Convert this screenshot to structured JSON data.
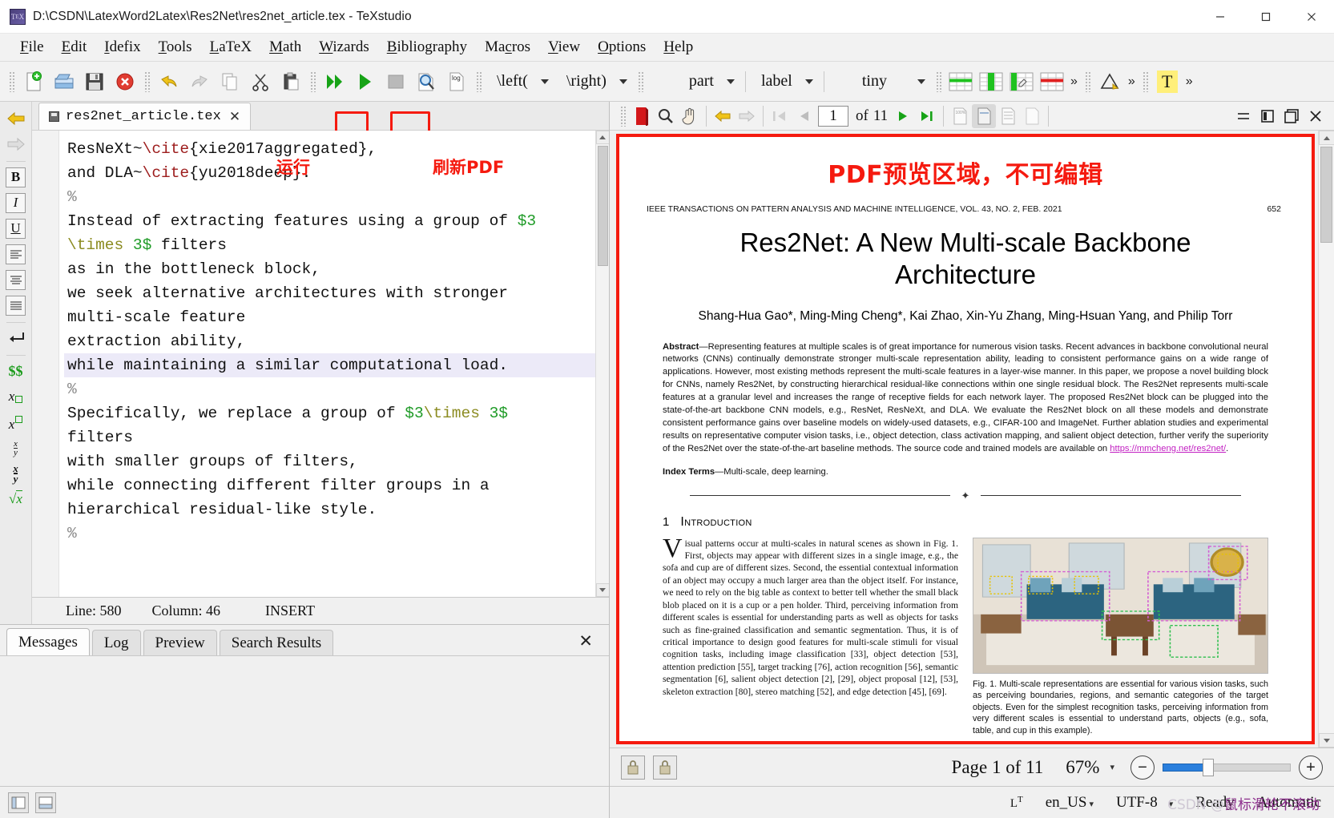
{
  "window": {
    "title": "D:\\CSDN\\LatexWord2Latex\\Res2Net\\res2net_article.tex - TeXstudio",
    "minimize": "–",
    "maximize": "☐",
    "close": "✕"
  },
  "menu": [
    {
      "label": "File",
      "accel": "F"
    },
    {
      "label": "Edit",
      "accel": "E"
    },
    {
      "label": "Idefix",
      "accel": "I"
    },
    {
      "label": "Tools",
      "accel": "T"
    },
    {
      "label": "LaTeX",
      "accel": "L"
    },
    {
      "label": "Math",
      "accel": "M"
    },
    {
      "label": "Wizards",
      "accel": "W"
    },
    {
      "label": "Bibliography",
      "accel": "B"
    },
    {
      "label": "Macros",
      "accel": "c"
    },
    {
      "label": "View",
      "accel": "V"
    },
    {
      "label": "Options",
      "accel": "O"
    },
    {
      "label": "Help",
      "accel": "H"
    }
  ],
  "toolbar": {
    "icons": [
      "new-file-icon",
      "open-file-icon",
      "save-file-icon",
      "close-file-icon",
      "undo-icon",
      "redo-icon",
      "copy-icon",
      "cut-icon",
      "paste-icon",
      "build-and-view-icon",
      "compile-run-icon",
      "stop-icon",
      "view-pdf-icon",
      "log-icon"
    ],
    "combos": [
      {
        "label": "\\left(",
        "name": "left-delimiter-combo"
      },
      {
        "label": "\\right)",
        "name": "right-delimiter-combo"
      },
      {
        "label": "part",
        "name": "section-level-combo"
      },
      {
        "label": "label",
        "name": "label-combo"
      },
      {
        "label": "tiny",
        "name": "font-size-combo"
      }
    ],
    "table_icons": [
      "table-insert-row-icon",
      "table-insert-column-icon",
      "table-edit-icon",
      "table-delete-row-icon"
    ],
    "overflow": "»",
    "extra_icons": [
      "triangle-tool-icon",
      "text-tool-icon"
    ]
  },
  "annotations": [
    {
      "text": "运行",
      "name": "run-annotation"
    },
    {
      "text": "刷新PDF",
      "name": "refresh-pdf-annotation"
    },
    {
      "text": "PDF预览区域，不可编辑",
      "name": "pdf-preview-annotation"
    }
  ],
  "sidebar": {
    "items": [
      {
        "label": "⬅",
        "name": "sidebar-back-icon"
      },
      {
        "label": "➡",
        "name": "sidebar-forward-icon"
      },
      {
        "label": "B",
        "name": "sidebar-bold-icon"
      },
      {
        "label": "I",
        "name": "sidebar-italic-icon"
      },
      {
        "label": "U",
        "name": "sidebar-underline-icon"
      },
      {
        "label": "≡",
        "name": "sidebar-align-left-icon"
      },
      {
        "label": "≡",
        "name": "sidebar-align-center-icon"
      },
      {
        "label": "≡",
        "name": "sidebar-align-right-icon"
      },
      {
        "label": "↵",
        "name": "sidebar-newline-icon"
      },
      {
        "label": "$$",
        "name": "sidebar-display-math-icon"
      },
      {
        "label": "x□",
        "name": "sidebar-subscript-icon"
      },
      {
        "label": "x□",
        "name": "sidebar-superscript-icon"
      },
      {
        "label": "x/y",
        "name": "sidebar-fraction-icon"
      },
      {
        "label": "x/y",
        "name": "sidebar-dfrac-icon"
      },
      {
        "label": "√x",
        "name": "sidebar-sqrt-icon"
      }
    ]
  },
  "editor": {
    "tab": {
      "filename": "res2net_article.tex",
      "close": "✕"
    },
    "lines": [
      {
        "id": 1,
        "highlight": false,
        "segments": [
          {
            "t": "ResNeXt~",
            "c": "plain"
          },
          {
            "t": "\\cite",
            "c": "cmd"
          },
          {
            "t": "{xie2017aggregated},",
            "c": "plain"
          }
        ]
      },
      {
        "id": 2,
        "highlight": false,
        "segments": [
          {
            "t": "and DLA~",
            "c": "plain"
          },
          {
            "t": "\\cite",
            "c": "cmd"
          },
          {
            "t": "{yu2018deep}.",
            "c": "plain"
          }
        ]
      },
      {
        "id": 3,
        "highlight": false,
        "segments": [
          {
            "t": "%",
            "c": "pct"
          }
        ]
      },
      {
        "id": 4,
        "highlight": false,
        "segments": [
          {
            "t": "Instead of extracting features using a group of ",
            "c": "plain"
          },
          {
            "t": "$3",
            "c": "math"
          }
        ]
      },
      {
        "id": 5,
        "highlight": false,
        "segments": [
          {
            "t": "\\times",
            "c": "texcmd"
          },
          {
            "t": " ",
            "c": "plain"
          },
          {
            "t": "3$",
            "c": "math"
          },
          {
            "t": " filters",
            "c": "plain"
          }
        ]
      },
      {
        "id": 6,
        "highlight": false,
        "segments": [
          {
            "t": "as in the bottleneck block,",
            "c": "plain"
          }
        ]
      },
      {
        "id": 7,
        "highlight": false,
        "segments": [
          {
            "t": "we seek alternative architectures with stronger",
            "c": "plain"
          }
        ]
      },
      {
        "id": 8,
        "highlight": false,
        "segments": [
          {
            "t": "multi-scale feature",
            "c": "plain"
          }
        ]
      },
      {
        "id": 9,
        "highlight": false,
        "segments": [
          {
            "t": "extraction ability,",
            "c": "plain"
          }
        ]
      },
      {
        "id": 10,
        "highlight": true,
        "segments": [
          {
            "t": "while maintaining a similar computational load.",
            "c": "plain"
          }
        ]
      },
      {
        "id": 11,
        "highlight": false,
        "segments": [
          {
            "t": "%",
            "c": "pct"
          }
        ]
      },
      {
        "id": 12,
        "highlight": false,
        "segments": [
          {
            "t": "Specifically, we replace a group of ",
            "c": "plain"
          },
          {
            "t": "$3",
            "c": "math"
          },
          {
            "t": "\\times",
            "c": "texcmd"
          },
          {
            "t": " ",
            "c": "plain"
          },
          {
            "t": "3$",
            "c": "math"
          }
        ]
      },
      {
        "id": 13,
        "highlight": false,
        "segments": [
          {
            "t": "filters",
            "c": "plain"
          }
        ]
      },
      {
        "id": 14,
        "highlight": false,
        "segments": [
          {
            "t": "with smaller groups of filters,",
            "c": "plain"
          }
        ]
      },
      {
        "id": 15,
        "highlight": false,
        "segments": [
          {
            "t": "while connecting different filter groups in a",
            "c": "plain"
          }
        ]
      },
      {
        "id": 16,
        "highlight": false,
        "segments": [
          {
            "t": "hierarchical residual-like style.",
            "c": "plain"
          }
        ]
      },
      {
        "id": 17,
        "highlight": false,
        "segments": [
          {
            "t": "%",
            "c": "pct"
          }
        ]
      }
    ],
    "status": {
      "line": "Line: 580",
      "column": "Column: 46",
      "mode": "INSERT"
    }
  },
  "messages_panel": {
    "tabs": [
      {
        "label": "Messages",
        "active": true
      },
      {
        "label": "Log",
        "active": false
      },
      {
        "label": "Preview",
        "active": false
      },
      {
        "label": "Search Results",
        "active": false
      }
    ],
    "close": "✕"
  },
  "pdf_toolbar": {
    "icons": [
      "pdf-file-icon",
      "magnify-icon",
      "hand-tool-icon",
      "back-arrow-icon",
      "forward-arrow-icon",
      "first-page-icon",
      "prev-page-icon"
    ],
    "page_value": "1",
    "of_label": "of",
    "page_count": "11",
    "next_icons": [
      "next-page-icon",
      "last-page-icon"
    ],
    "view_mode_icons": [
      "fit-width-icon",
      "fit-page-icon",
      "continuous-icon",
      "single-page-icon"
    ],
    "window_icons": [
      "minimize-pdf-icon",
      "embed-pdf-icon",
      "detach-pdf-icon",
      "close-pdf-icon"
    ]
  },
  "pdf": {
    "journal_header": "IEEE TRANSACTIONS ON PATTERN ANALYSIS AND MACHINE INTELLIGENCE, VOL. 43, NO. 2, FEB. 2021",
    "page_number": "652",
    "title": "Res2Net: A New Multi-scale Backbone Architecture",
    "authors": "Shang-Hua Gao*,  Ming-Ming Cheng*,  Kai Zhao,  Xin-Yu Zhang,  Ming-Hsuan Yang,  and Philip Torr",
    "abstract_label": "Abstract",
    "abstract_body": "—Representing features at multiple scales is of great importance for numerous vision tasks. Recent advances in backbone convolutional neural networks (CNNs) continually demonstrate stronger multi-scale representation ability, leading to consistent performance gains on a wide range of applications. However, most existing methods represent the multi-scale features in a layer-wise manner. In this paper, we propose a novel building block for CNNs, namely Res2Net, by constructing hierarchical residual-like connections within one single residual block. The Res2Net represents multi-scale features at a granular level and increases the range of receptive fields for each network layer. The proposed Res2Net block can be plugged into the state-of-the-art backbone CNN models, e.g., ResNet, ResNeXt, and DLA. We evaluate the Res2Net block on all these models and demonstrate consistent performance gains over baseline models on widely-used datasets, e.g., CIFAR-100 and ImageNet. Further ablation studies and experimental results on representative computer vision tasks, i.e., object detection, class activation mapping, and salient object detection, further verify the superiority of the Res2Net over the state-of-the-art baseline methods. The source code and trained models are available on ",
    "abstract_link": "https://mmcheng.net/res2net/",
    "abstract_tail": ".",
    "index_terms_label": "Index Terms",
    "index_terms_body": "—Multi-scale, deep learning.",
    "section_number": "1",
    "section_title": "Introduction",
    "dropcap": "V",
    "intro_col1": "isual patterns occur at multi-scales in natural scenes as shown in Fig. 1. First, objects may appear with different sizes in a single image, e.g., the sofa and cup are of different sizes. Second, the essential contextual information of an object may occupy a much larger area than the object itself. For instance, we need to rely on the big table as context to better tell whether the small black blob placed on it is a cup or a pen holder. Third, perceiving information from different scales is essential for understanding parts as well as objects for tasks such as fine-grained classification and semantic segmentation. Thus, it is of critical importance to design good features for multi-scale stimuli for visual cognition tasks, including image classification [33], object detection [53], attention prediction [55], target tracking [76], action recognition [56], semantic segmentation [6], salient object detection [2], [29], object proposal [12], [53], skeleton extraction [80], stereo matching [52], and edge detection [45], [69].",
    "figure_caption": "Fig. 1. Multi-scale representations are essential for various vision tasks, such as perceiving boundaries, regions, and semantic categories of the target objects. Even for the simplest recognition tasks, perceiving information from very different scales is essential to understand parts, objects (e.g., sofa, table, and cup in this example).",
    "figure_alt": "living-room-photo-with-detection-boxes"
  },
  "pdf_status": {
    "lock_icons": [
      "lock-left-icon",
      "lock-right-icon"
    ],
    "page_label": "Page 1 of 11",
    "zoom_label": "67%",
    "zoom_dropdown": "▾",
    "zoom_out": "−",
    "zoom_in": "+"
  },
  "app_status": {
    "left_icons": [
      "toggle-structure-icon",
      "toggle-panel-icon"
    ],
    "spell_icon": "LT",
    "language": "en_US",
    "encoding": "UTF-8",
    "state": "Ready",
    "mode": "Automatic",
    "dropdown": "▾"
  },
  "watermark": "CSDN @鼠标滑轮不滚动",
  "colors": {
    "accent_red": "#f51a0f",
    "toolbar_bg": "#f2f2f2",
    "highlight_line": "#eceaf8",
    "math_green": "#1f9b27",
    "cmd_red": "#9d1d1d",
    "slider_blue": "#2a7fdd"
  }
}
